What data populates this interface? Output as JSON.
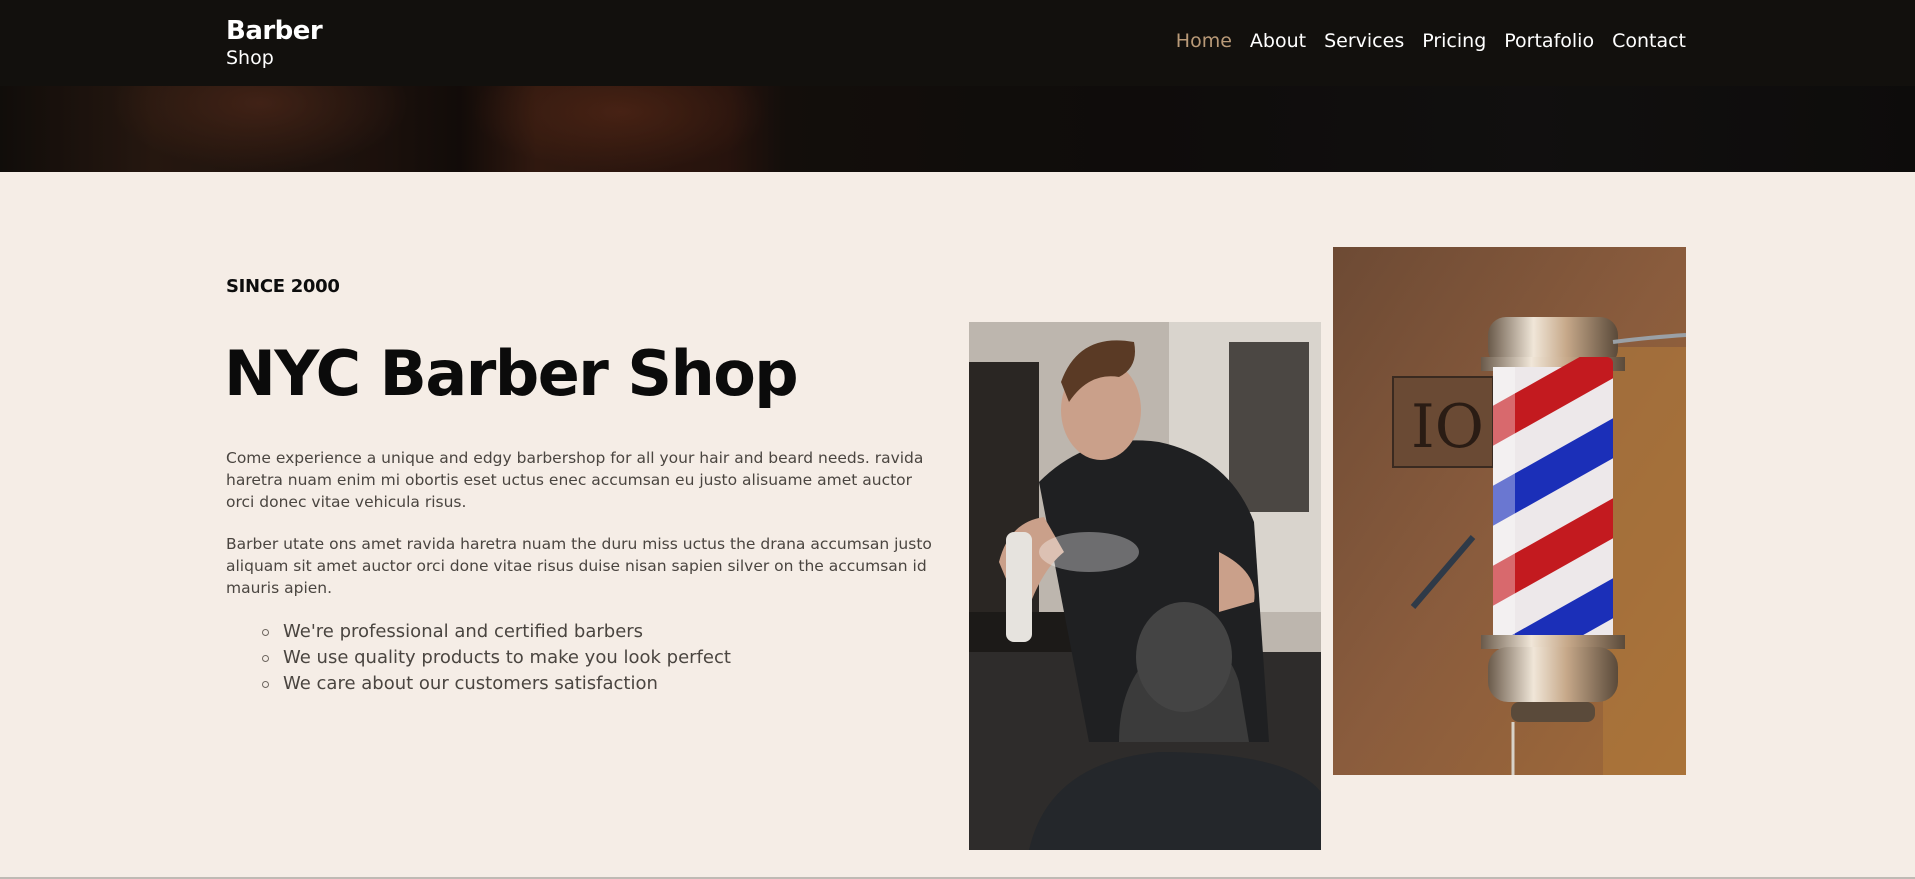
{
  "brand": {
    "name": "Barber",
    "sub": "Shop"
  },
  "nav": {
    "items": [
      {
        "label": "Home",
        "active": true
      },
      {
        "label": "About",
        "active": false
      },
      {
        "label": "Services",
        "active": false
      },
      {
        "label": "Pricing",
        "active": false
      },
      {
        "label": "Portafolio",
        "active": false
      },
      {
        "label": "Contact",
        "active": false
      }
    ],
    "active_color": "#b99a78"
  },
  "about": {
    "eyebrow": "SINCE 2000",
    "title": "NYC Barber Shop",
    "paragraphs": [
      "Come experience a unique and edgy barbershop for all your hair and beard needs. ravida haretra nuam enim mi obortis eset uctus enec accumsan eu justo alisuame amet auctor orci donec vitae vehicula risus.",
      "Barber utate ons amet ravida haretra nuam the duru miss uctus the drana accumsan justo aliquam sit amet auctor orci done vitae risus duise nisan sapien silver on the accumsan id mauris apien."
    ],
    "features": [
      "We're professional and certified barbers",
      "We use quality products to make you look perfect",
      "We care about our customers satisfaction"
    ]
  },
  "images": {
    "barber_photo": "photo-barber-spraying-client",
    "pole_photo": "photo-barber-pole"
  },
  "colors": {
    "header_bg": "#12100d",
    "page_bg": "#f5ede6",
    "text_dark": "#0b0b0b",
    "text_body": "#4a4540"
  }
}
